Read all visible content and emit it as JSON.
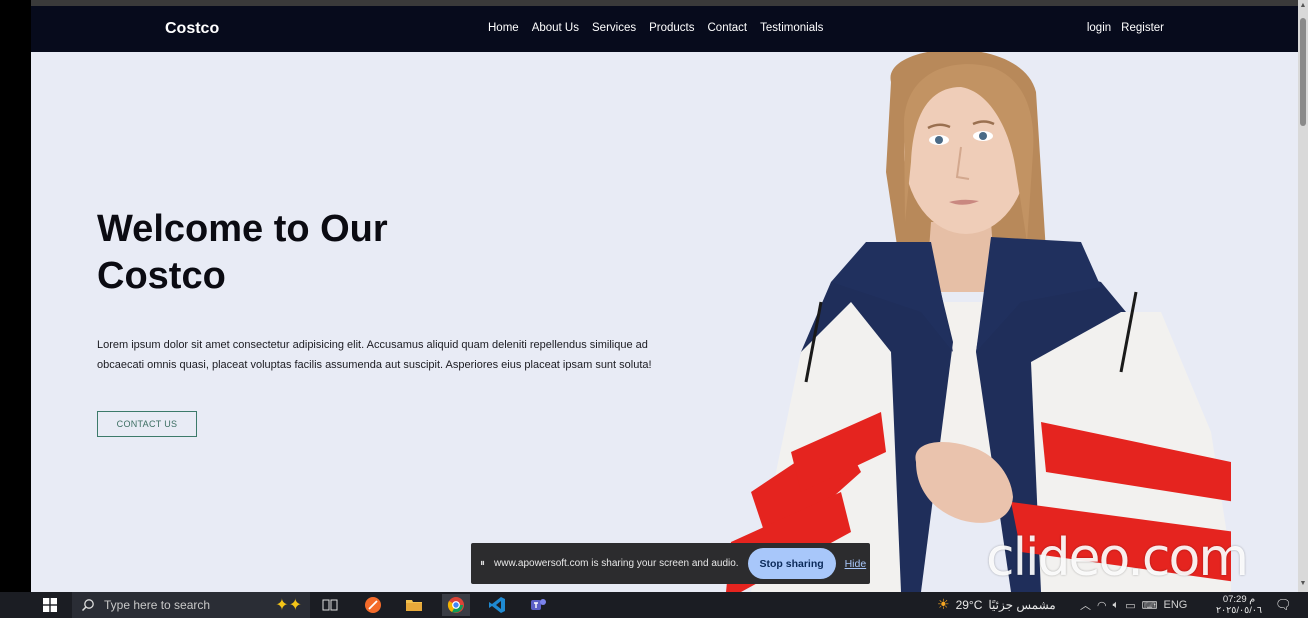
{
  "site": {
    "brand": "Costco",
    "nav": [
      "Home",
      "About Us",
      "Services",
      "Products",
      "Contact",
      "Testimonials"
    ],
    "auth": [
      "login",
      "Register"
    ]
  },
  "hero": {
    "title_line1": "Welcome to Our",
    "title_line2": "Costco",
    "text": "Lorem ipsum dolor sit amet consectetur adipisicing elit. Accusamus aliquid quam deleniti repellendus similique ad obcaecati omnis quasi, placeat voluptas facilis assumenda aut suscipit. Asperiores eius placeat ipsam sunt soluta!",
    "button": "CONTACT US"
  },
  "watermark": "clideo.com",
  "sharing_bar": {
    "message": "www.apowersoft.com is sharing your screen and audio.",
    "stop_label": "Stop sharing",
    "hide_label": "Hide"
  },
  "taskbar": {
    "search_placeholder": "Type here to search",
    "weather_temp": "29°C",
    "weather_desc": "مشمس جزئيًا",
    "language": "ENG",
    "time": "07:29 م",
    "date": "٢٠٢٥/٠٥/٠٦"
  },
  "colors": {
    "navbar": "#070b1c",
    "hero_bg": "#e8ebf5",
    "button_border": "#3c7a6a",
    "stop_sharing": "#a8c7fa",
    "taskbar": "#1b1d23"
  }
}
